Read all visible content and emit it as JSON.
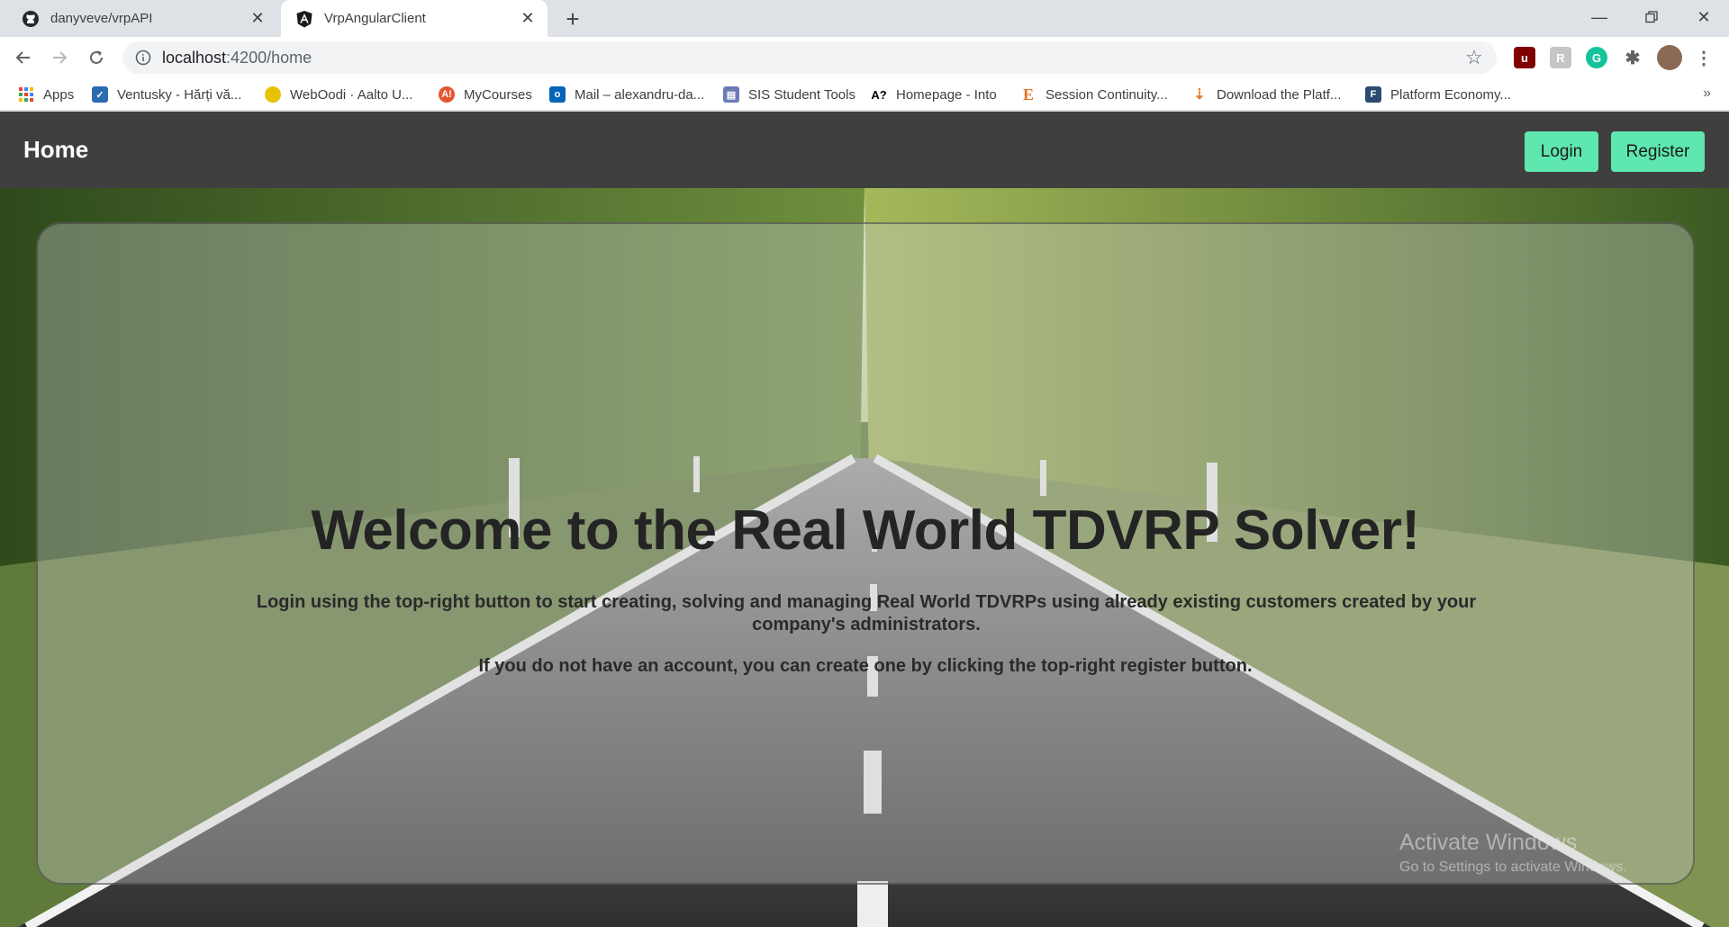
{
  "tabs": [
    {
      "title": "danyveve/vrpAPI",
      "icon": "github-icon"
    },
    {
      "title": "VrpAngularClient",
      "icon": "angular-icon"
    }
  ],
  "address_bar": {
    "host": "localhost",
    "path": ":4200/home"
  },
  "bookmarks": [
    {
      "label": "Apps",
      "icon": "apps-grid-icon",
      "color": "#4285f4"
    },
    {
      "label": "Ventusky - Hărți vă...",
      "icon": "ventusky-icon",
      "color": "#2b6cb0"
    },
    {
      "label": "WebOodi · Aalto U...",
      "icon": "weboodi-icon",
      "color": "#e6c200"
    },
    {
      "label": "MyCourses",
      "icon": "mycourses-icon",
      "color": "#e4572e"
    },
    {
      "label": "Mail – alexandru-da...",
      "icon": "outlook-icon",
      "color": "#0364b8"
    },
    {
      "label": "SIS Student Tools",
      "icon": "sis-icon",
      "color": "#6b7bb5"
    },
    {
      "label": "Homepage - Into",
      "icon": "into-icon",
      "color": "#000000"
    },
    {
      "label": "Session Continuity...",
      "icon": "session-icon",
      "color": "#e8742a"
    },
    {
      "label": "Download the Platf...",
      "icon": "download-icon",
      "color": "#e8742a"
    },
    {
      "label": "Platform Economy...",
      "icon": "platform-icon",
      "color": "#2b4a6f"
    }
  ],
  "navbar": {
    "brand": "Home",
    "login_label": "Login",
    "register_label": "Register",
    "button_color": "#5ee8b0"
  },
  "hero": {
    "headline": "Welcome to the Real World TDVRP Solver!",
    "lead": "Login using the top-right button to start creating, solving and managing Real World TDVRPs using already existing customers created by your company's administrators.",
    "lead2": "If you do not have an account, you can create one by clicking the top-right register button."
  },
  "watermark": {
    "line1": "Activate Windows",
    "line2": "Go to Settings to activate Windows."
  }
}
